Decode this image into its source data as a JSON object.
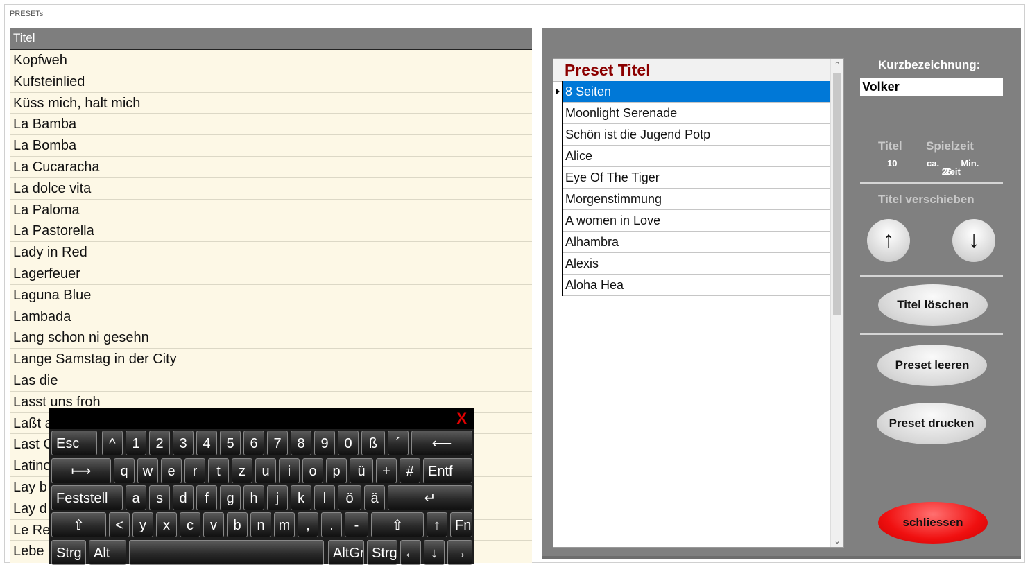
{
  "window": {
    "title": "PRESETs"
  },
  "left_list": {
    "header": "Titel",
    "items": [
      "Kopfweh",
      "Kufsteinlied",
      "Küss mich, halt mich",
      "La Bamba",
      "La Bomba",
      "La Cucaracha",
      "La dolce vita",
      "La Paloma",
      "La Pastorella",
      "Lady in Red",
      "Lagerfeuer",
      "Laguna Blue",
      "Lambada",
      "Lang schon ni gesehn",
      "Lange Samstag in der City",
      "Las die",
      "Lasst uns froh",
      "Laßt a",
      "Last C",
      "Latino",
      "Lay b",
      "Lay d",
      "Le Re",
      "Lebe"
    ]
  },
  "preset_table": {
    "header": "Preset Titel",
    "selected_index": 0,
    "rows": [
      "8 Seiten",
      "Moonlight Serenade",
      "Schön ist die Jugend Potp",
      "Alice",
      "Eye Of The Tiger",
      "Morgenstimmung",
      "A women in Love",
      "Alhambra",
      "Alexis",
      "Aloha Hea"
    ]
  },
  "controls": {
    "short_label": "Kurzbezeichnung:",
    "short_value": "Volker",
    "titel_label": "Titel",
    "spielzeit_label": "Spielzeit",
    "titel_count": "10",
    "spielzeit_prefix": "ca.",
    "spielzeit_overlay": "26",
    "spielzeit_value": "Zeit",
    "spielzeit_unit": "Min.",
    "move_label": "Titel verschieben",
    "up_arrow": "↑",
    "down_arrow": "↓",
    "delete_label": "Titel löschen",
    "clear_label": "Preset leeren",
    "print_label": "Preset drucken",
    "close_label": "schliessen",
    "colors": {
      "close_button": "#f01010",
      "preset_header": "#8b0000",
      "selected_row": "#0078d7"
    }
  },
  "keyboard": {
    "close": "X",
    "rows": [
      [
        "Esc",
        "^",
        "1",
        "2",
        "3",
        "4",
        "5",
        "6",
        "7",
        "8",
        "9",
        "0",
        "ß",
        "´",
        "⟵"
      ],
      [
        "⟼",
        "q",
        "w",
        "e",
        "r",
        "t",
        "z",
        "u",
        "i",
        "o",
        "p",
        "ü",
        "+",
        "#",
        "Entf"
      ],
      [
        "Feststell",
        "a",
        "s",
        "d",
        "f",
        "g",
        "h",
        "j",
        "k",
        "l",
        "ö",
        "ä",
        "↵"
      ],
      [
        "⇧",
        "<",
        "y",
        "x",
        "c",
        "v",
        "b",
        "n",
        "m",
        ",",
        ".",
        "-",
        "⇧",
        "↑",
        "Fn"
      ],
      [
        "Strg",
        "Alt",
        " ",
        "AltGr",
        "Strg",
        "←",
        "↓",
        "→"
      ]
    ]
  }
}
